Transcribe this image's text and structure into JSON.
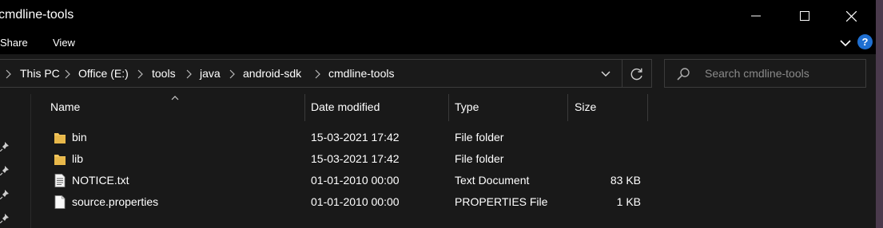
{
  "window": {
    "title": "cmdline-tools"
  },
  "ribbon": {
    "tabs": [
      {
        "label": "Share"
      },
      {
        "label": "View"
      }
    ],
    "help_label": "?"
  },
  "address": {
    "crumbs": [
      "This PC",
      "Office (E:)",
      "tools",
      "java",
      "android-sdk",
      "cmdline-tools"
    ]
  },
  "search": {
    "placeholder": "Search cmdline-tools"
  },
  "columns": {
    "name": "Name",
    "date": "Date modified",
    "type": "Type",
    "size": "Size"
  },
  "files": [
    {
      "name": "bin",
      "date": "15-03-2021 17:42",
      "type": "File folder",
      "size": "",
      "icon": "folder-icon"
    },
    {
      "name": "lib",
      "date": "15-03-2021 17:42",
      "type": "File folder",
      "size": "",
      "icon": "folder-icon"
    },
    {
      "name": "NOTICE.txt",
      "date": "01-01-2010 00:00",
      "type": "Text Document",
      "size": "83 KB",
      "icon": "text-file-icon"
    },
    {
      "name": "source.properties",
      "date": "01-01-2010 00:00",
      "type": "PROPERTIES File",
      "size": "1 KB",
      "icon": "file-icon"
    }
  ],
  "colors": {
    "accent": "#1f6fd1",
    "folder": "#f2c55c",
    "background": "#191919"
  }
}
